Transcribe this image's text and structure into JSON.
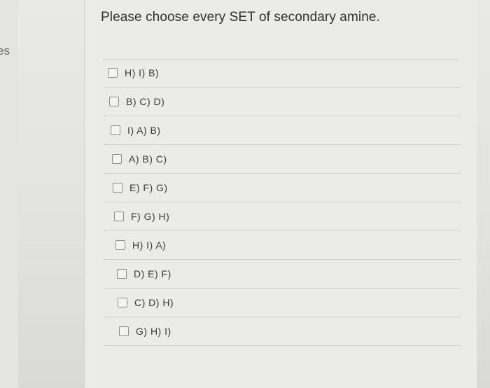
{
  "sidebar": {
    "partial_text": "es"
  },
  "question": {
    "text": "Please choose every SET of secondary amine."
  },
  "options": [
    {
      "label": "H) I) B)"
    },
    {
      "label": "B) C) D)"
    },
    {
      "label": "I) A) B)"
    },
    {
      "label": "A) B) C)"
    },
    {
      "label": "E) F) G)"
    },
    {
      "label": "F) G) H)"
    },
    {
      "label": "H) I) A)"
    },
    {
      "label": "D) E) F)"
    },
    {
      "label": "C) D) H)"
    },
    {
      "label": "G) H) I)"
    }
  ]
}
